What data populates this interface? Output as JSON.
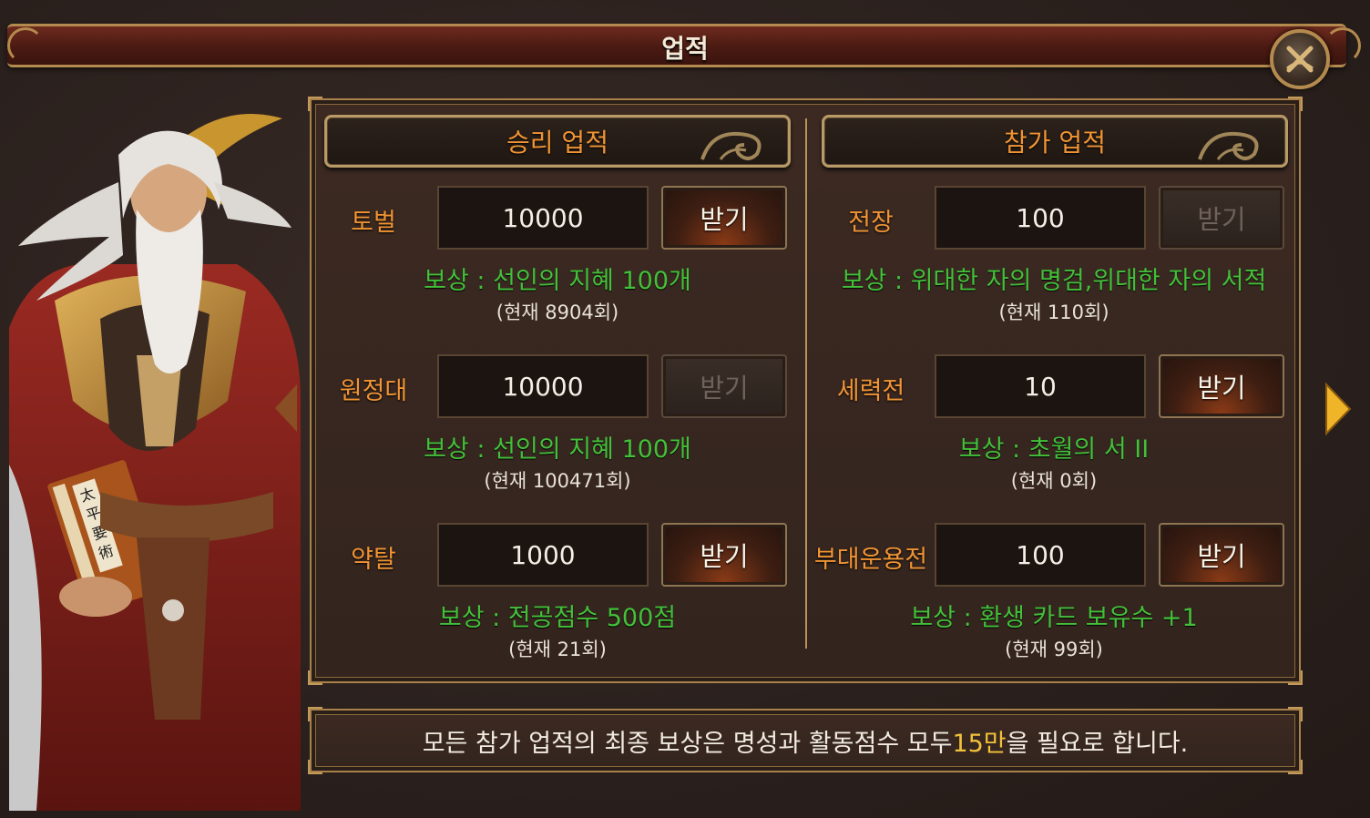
{
  "header": {
    "title": "업적"
  },
  "columns": [
    {
      "title": "승리 업적",
      "rows": [
        {
          "label": "토벌",
          "value": "10000",
          "button": "받기",
          "button_enabled": true,
          "reward": "보상 : 선인의 지혜 100개",
          "current": "(현재 8904회)"
        },
        {
          "label": "원정대",
          "value": "10000",
          "button": "받기",
          "button_enabled": false,
          "reward": "보상 : 선인의 지혜 100개",
          "current": "(현재 100471회)"
        },
        {
          "label": "약탈",
          "value": "1000",
          "button": "받기",
          "button_enabled": true,
          "reward": "보상 : 전공점수 500점",
          "current": "(현재 21회)"
        }
      ]
    },
    {
      "title": "참가 업적",
      "rows": [
        {
          "label": "전장",
          "value": "100",
          "button": "받기",
          "button_enabled": false,
          "reward": "보상 : 위대한 자의 명검,위대한 자의 서적",
          "current": "(현재 110회)"
        },
        {
          "label": "세력전",
          "value": "10",
          "button": "받기",
          "button_enabled": true,
          "reward": "보상 : 초월의 서 II",
          "current": "(현재 0회)"
        },
        {
          "label": "부대운용전",
          "value": "100",
          "button": "받기",
          "button_enabled": true,
          "reward": "보상 : 환생 카드 보유수 +1",
          "current": "(현재 99회)"
        }
      ]
    }
  ],
  "footer": {
    "text_before": "모든 참가 업적의 최종 보상은 명성과 활동점수 모두 ",
    "highlight": "15만",
    "text_after": "을 필요로 합니다."
  },
  "portrait": {
    "book_text": "太平要術"
  },
  "icons": {
    "close": "close-x-icon",
    "next": "arrow-right-icon",
    "prev": "arrow-left-icon"
  },
  "colors": {
    "label_orange": "#f09434",
    "reward_green": "#43c03a",
    "highlight_yellow": "#f2c23a",
    "frame_gold": "#b48a4e"
  }
}
